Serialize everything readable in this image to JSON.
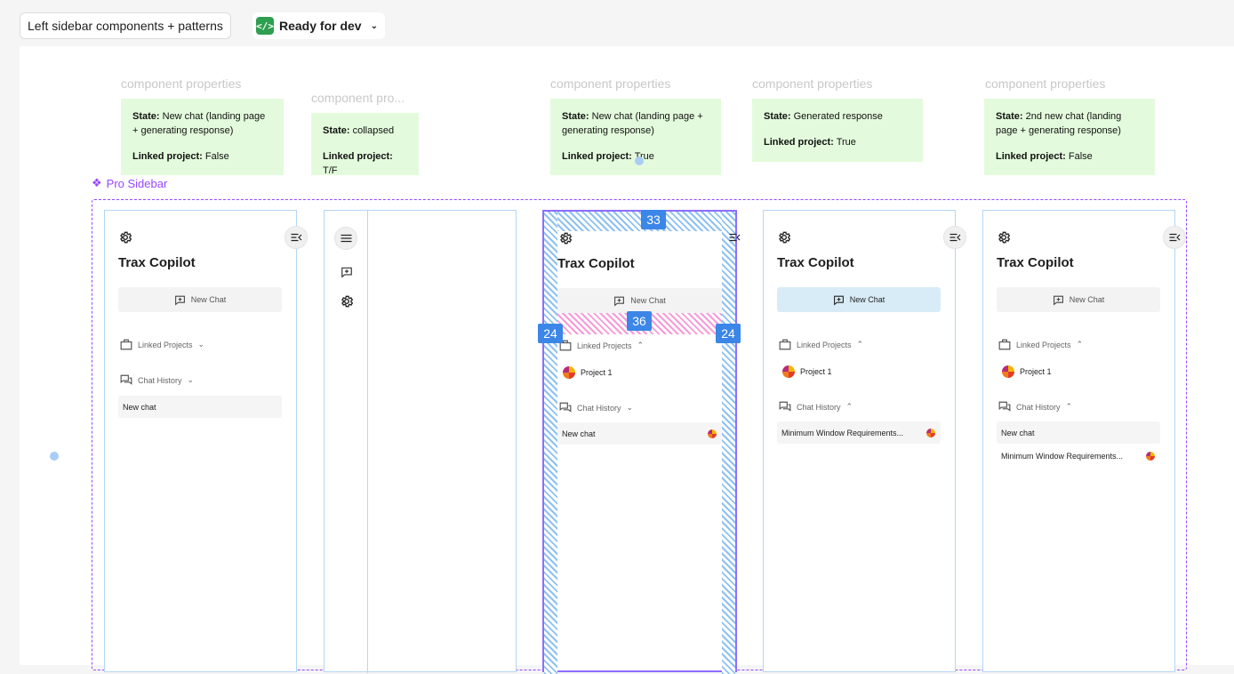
{
  "toolbar": {
    "page_name": "Left sidebar components + patterns",
    "status_label": "Ready for dev",
    "status_icon": "code-icon"
  },
  "annotations": [
    {
      "label": "component properties",
      "state": "New chat (landing page + generating response)",
      "linked_project": "False"
    },
    {
      "label": "component pro...",
      "state": "collapsed",
      "linked_project": "T/F"
    },
    {
      "label": "component properties",
      "state": "New chat (landing page + generating response)",
      "linked_project": "True"
    },
    {
      "label": "component properties",
      "state": "Generated response",
      "linked_project": "True"
    },
    {
      "label": "component properties",
      "state": "2nd new chat  (landing page + generating response)",
      "linked_project": "False"
    }
  ],
  "annotation_keys": {
    "state": "State:",
    "linked_project": "Linked project:"
  },
  "component_set": {
    "title": "Pro Sidebar"
  },
  "sidebar": {
    "brand": "Trax Copilot",
    "new_chat": "New Chat",
    "linked_projects": "Linked Projects",
    "chat_history": "Chat History",
    "project": "Project 1",
    "new_chat_item": "New chat",
    "response_item": "Minimum Window Requirements..."
  },
  "spacing_badges": {
    "top": "33",
    "middle": "36",
    "left": "24",
    "right": "24"
  },
  "colors": {
    "component_set": "#9747ff",
    "annotation_bg": "#e3fbdc",
    "frame_border": "#b3d6f5",
    "spacing_badge": "#3b86e6"
  }
}
